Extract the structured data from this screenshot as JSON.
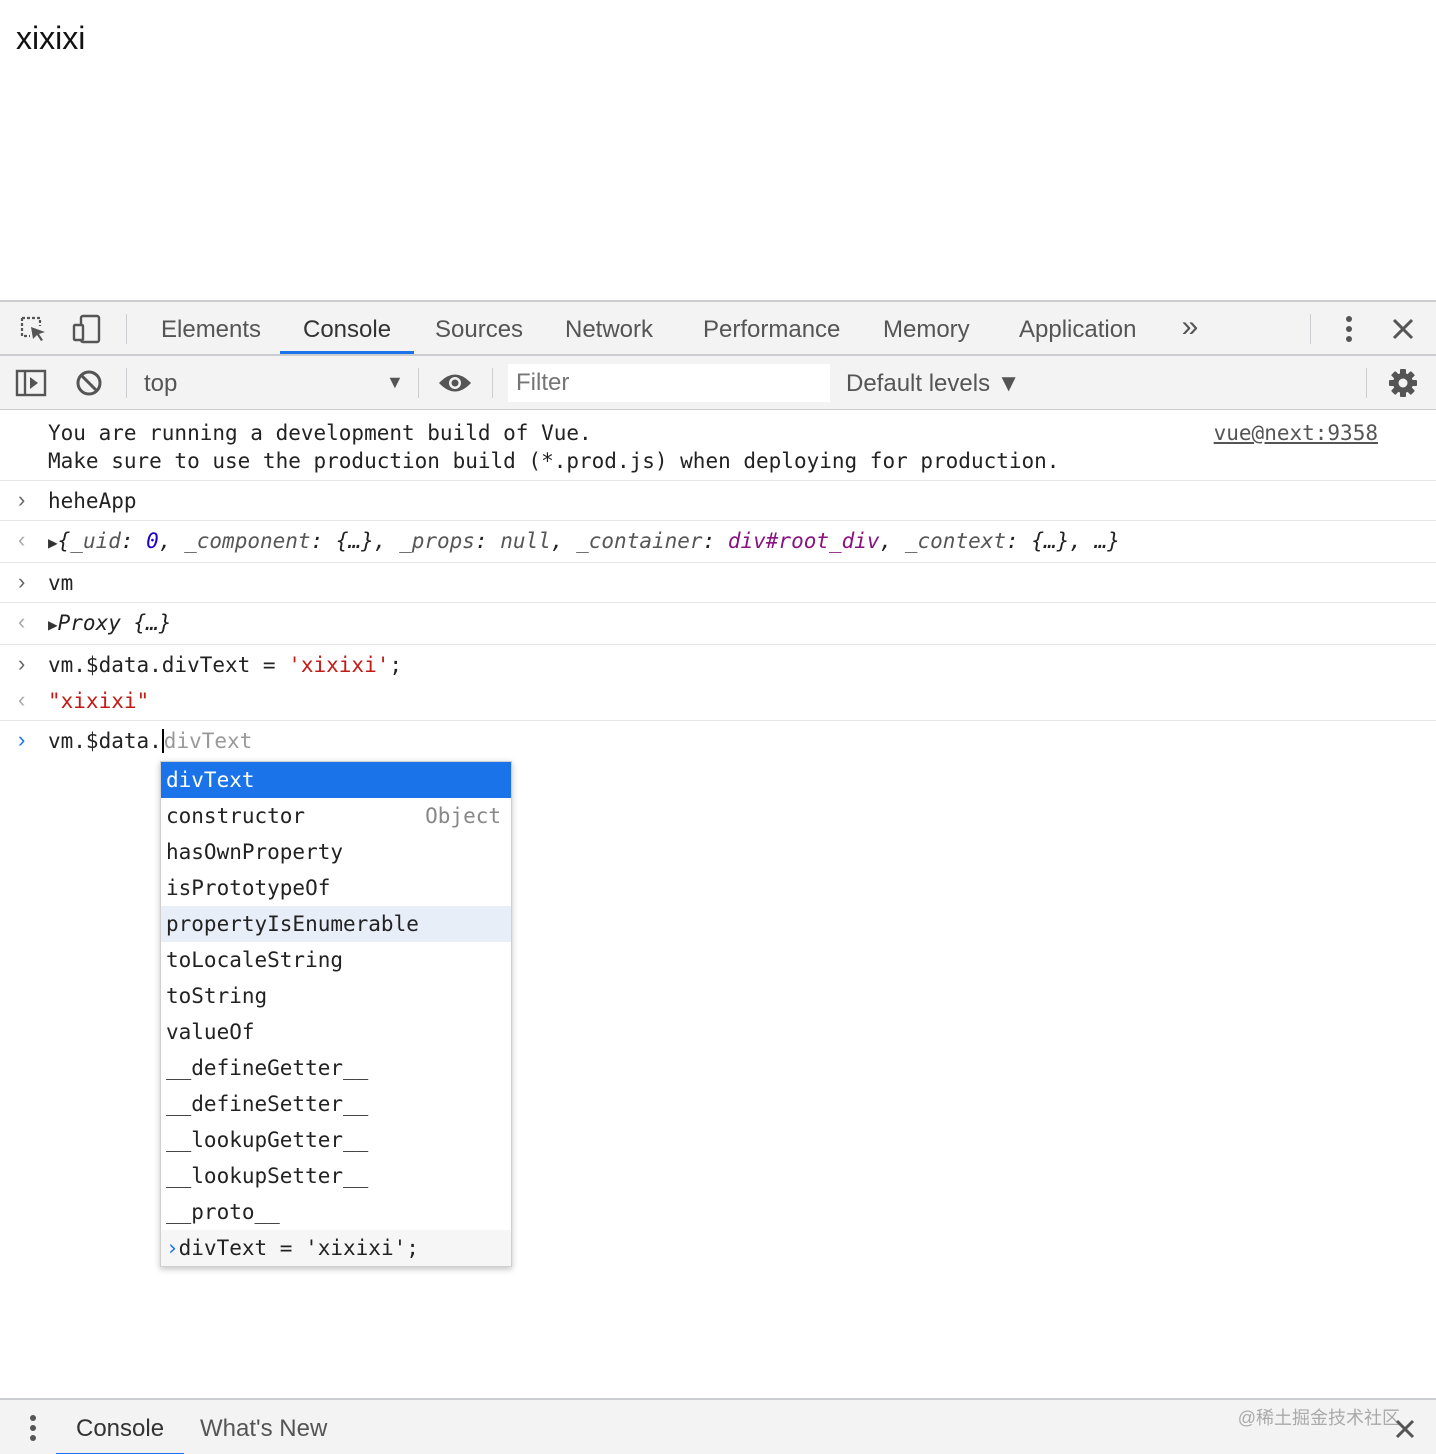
{
  "page": {
    "text": "xixixi"
  },
  "devtools": {
    "tabs": [
      {
        "label": "Elements"
      },
      {
        "label": "Console"
      },
      {
        "label": "Sources"
      },
      {
        "label": "Network"
      },
      {
        "label": "Performance"
      },
      {
        "label": "Memory"
      },
      {
        "label": "Application"
      }
    ],
    "active_tab": "Console",
    "more_tabs_glyph": "»",
    "close_glyph": "✕",
    "menu_glyph": "⋮"
  },
  "console_toolbar": {
    "context": "top",
    "filter_placeholder": "Filter",
    "levels": "Default levels ▼"
  },
  "messages": {
    "warning_line1": "You are running a development build of Vue.",
    "warning_line2": "Make sure to use the production build (*.prod.js) when deploying for production.",
    "warning_source": "vue@next:9358",
    "input1": "heheApp",
    "output1": {
      "open": "{",
      "k1": "_uid",
      "v1": "0",
      "k2": "_component",
      "v2": "{…}",
      "k3": "_props",
      "v3": "null",
      "k4": "_container",
      "v4": "div#root_div",
      "k5": "_context",
      "v5": "{…}",
      "tail": "…}"
    },
    "input2": "vm",
    "output2_name": "Proxy",
    "output2_value": "{…}",
    "input3_code": "vm.$data.divText = ",
    "input3_string": "'xixixi'",
    "input3_end": ";",
    "output3": "\"xixixi\"",
    "current_input": "vm.$data.",
    "current_suggestion": "divText"
  },
  "autocomplete": {
    "items": [
      {
        "label": "divText",
        "hint": ""
      },
      {
        "label": "constructor",
        "hint": "Object"
      },
      {
        "label": "hasOwnProperty",
        "hint": ""
      },
      {
        "label": "isPrototypeOf",
        "hint": ""
      },
      {
        "label": "propertyIsEnumerable",
        "hint": ""
      },
      {
        "label": "toLocaleString",
        "hint": ""
      },
      {
        "label": "toString",
        "hint": ""
      },
      {
        "label": "valueOf",
        "hint": ""
      },
      {
        "label": "__defineGetter__",
        "hint": ""
      },
      {
        "label": "__defineSetter__",
        "hint": ""
      },
      {
        "label": "__lookupGetter__",
        "hint": ""
      },
      {
        "label": "__lookupSetter__",
        "hint": ""
      },
      {
        "label": "__proto__",
        "hint": ""
      },
      {
        "label": "divText = 'xixixi';",
        "hint": ""
      }
    ]
  },
  "drawer": {
    "tabs": [
      {
        "label": "Console"
      },
      {
        "label": "What's New"
      }
    ],
    "watermark": "@稀土掘金技术社区"
  },
  "colors": {
    "accent": "#1a73e8",
    "toolbar_bg": "#f3f3f3",
    "string": "#c41a16",
    "number": "#1c00cf",
    "node": "#881280"
  }
}
